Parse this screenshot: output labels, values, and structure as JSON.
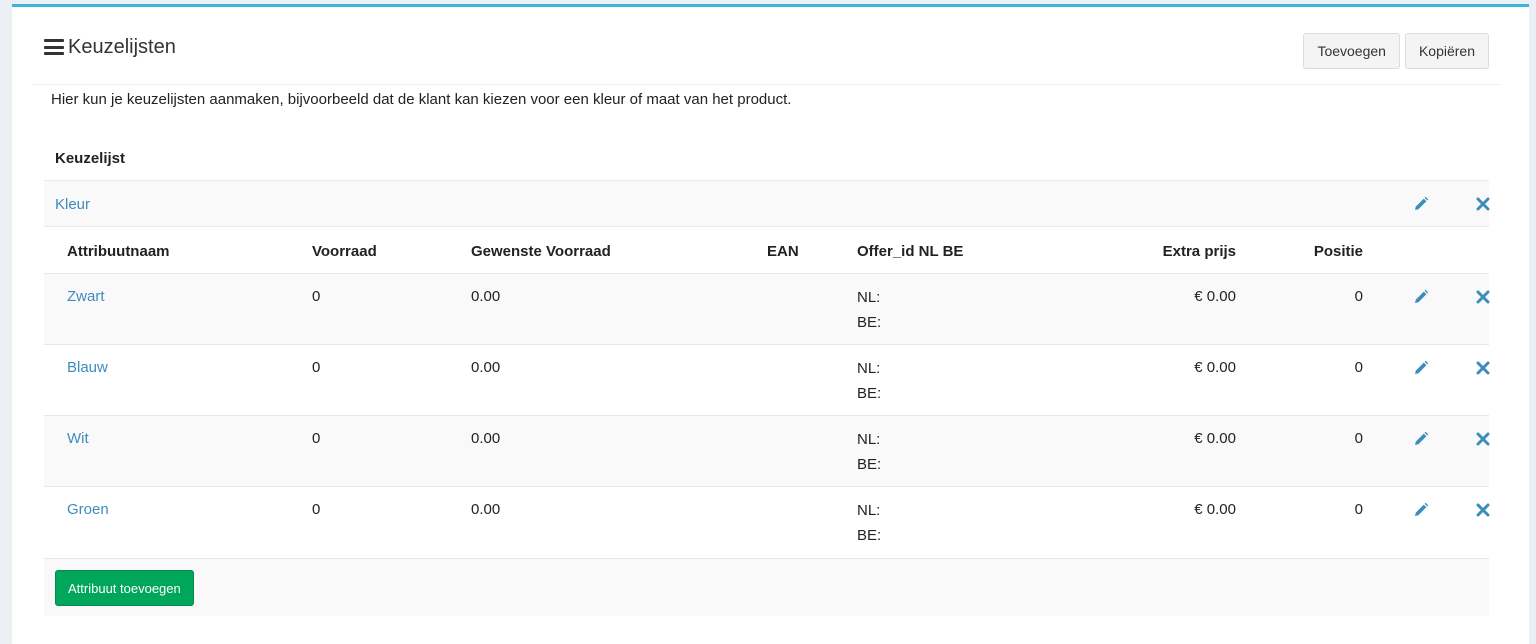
{
  "header": {
    "title": "Keuzelijsten",
    "buttons": {
      "add": "Toevoegen",
      "copy": "Kopiëren"
    }
  },
  "intro_text": "Hier kun je keuzelijsten aanmaken, bijvoorbeeld dat de klant kan kiezen voor een kleur of maat van het product.",
  "list_heading": "Keuzelijst",
  "group": {
    "name": "Kleur"
  },
  "columns": {
    "name": "Attribuutnaam",
    "stock": "Voorraad",
    "desired_stock": "Gewenste Voorraad",
    "ean": "EAN",
    "offer_id": "Offer_id NL BE",
    "extra_price": "Extra prijs",
    "position": "Positie"
  },
  "rows": [
    {
      "name": "Zwart",
      "stock": "0",
      "desired_stock": "0.00",
      "ean": "",
      "offer_nl": "NL:",
      "offer_be": "BE:",
      "extra_price": "€ 0.00",
      "position": "0"
    },
    {
      "name": "Blauw",
      "stock": "0",
      "desired_stock": "0.00",
      "ean": "",
      "offer_nl": "NL:",
      "offer_be": "BE:",
      "extra_price": "€ 0.00",
      "position": "0"
    },
    {
      "name": "Wit",
      "stock": "0",
      "desired_stock": "0.00",
      "ean": "",
      "offer_nl": "NL:",
      "offer_be": "BE:",
      "extra_price": "€ 0.00",
      "position": "0"
    },
    {
      "name": "Groen",
      "stock": "0",
      "desired_stock": "0.00",
      "ean": "",
      "offer_nl": "NL:",
      "offer_be": "BE:",
      "extra_price": "€ 0.00",
      "position": "0"
    }
  ],
  "add_attribute_label": "Attribuut toevoegen",
  "icons": {
    "edit": "pencil-icon",
    "delete": "close-icon",
    "menu": "bars-icon"
  },
  "colors": {
    "accent_top": "#3cb4d8",
    "link": "#3c8dbc",
    "success": "#00a65a"
  }
}
